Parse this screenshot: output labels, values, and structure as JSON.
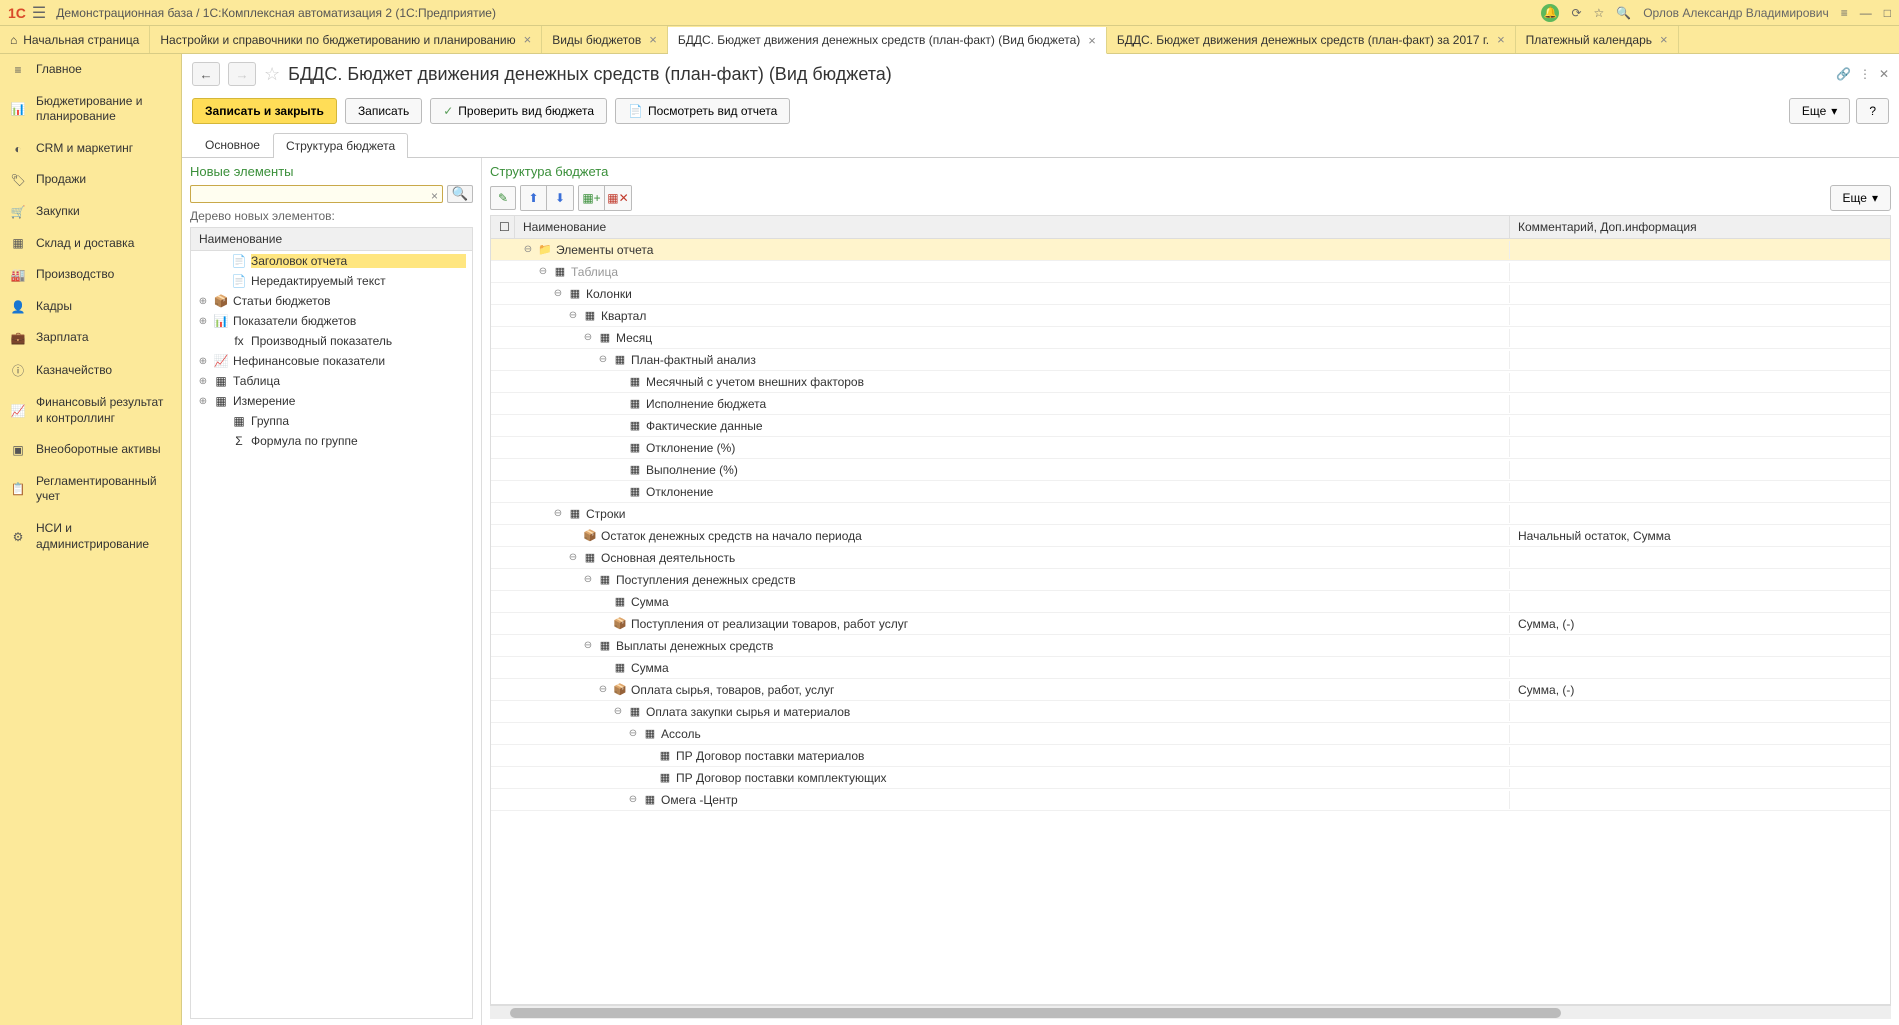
{
  "titleBar": {
    "logo": "1C",
    "title": "Демонстрационная база / 1С:Комплексная автоматизация 2 (1С:Предприятие)",
    "userName": "Орлов Александр Владимирович"
  },
  "tabs": [
    {
      "label": "Начальная страница",
      "home": true
    },
    {
      "label": "Настройки и справочники по бюджетированию и планированию",
      "closable": true
    },
    {
      "label": "Виды бюджетов",
      "closable": true
    },
    {
      "label": "БДДС. Бюджет движения денежных средств (план-факт) (Вид бюджета)",
      "closable": true,
      "active": true
    },
    {
      "label": "БДДС. Бюджет движения денежных средств (план-факт) за 2017 г.",
      "closable": true
    },
    {
      "label": "Платежный календарь",
      "closable": true
    }
  ],
  "sidebar": [
    {
      "icon": "≡",
      "label": "Главное"
    },
    {
      "icon": "📊",
      "label": "Бюджетирование и планирование"
    },
    {
      "icon": "◐",
      "label": "CRM и маркетинг"
    },
    {
      "icon": "🏷",
      "label": "Продажи"
    },
    {
      "icon": "🛒",
      "label": "Закупки"
    },
    {
      "icon": "▦",
      "label": "Склад и доставка"
    },
    {
      "icon": "🏭",
      "label": "Производство"
    },
    {
      "icon": "👤",
      "label": "Кадры"
    },
    {
      "icon": "💼",
      "label": "Зарплата"
    },
    {
      "icon": "ⓘ",
      "label": "Казначейство"
    },
    {
      "icon": "📈",
      "label": "Финансовый результат и контроллинг"
    },
    {
      "icon": "▣",
      "label": "Внеоборотные активы"
    },
    {
      "icon": "📋",
      "label": "Регламентированный учет"
    },
    {
      "icon": "⚙",
      "label": "НСИ и администрирование"
    }
  ],
  "page": {
    "title": "БДДС. Бюджет движения денежных средств (план-факт) (Вид бюджета)",
    "toolbar": {
      "saveClose": "Записать и закрыть",
      "save": "Записать",
      "check": "Проверить вид бюджета",
      "preview": "Посмотреть вид отчета",
      "more": "Еще",
      "help": "?"
    },
    "subTabs": {
      "main": "Основное",
      "structure": "Структура бюджета"
    }
  },
  "leftPanel": {
    "title": "Новые элементы",
    "treeCaption": "Дерево новых элементов:",
    "headerName": "Наименование",
    "items": [
      {
        "icon": "📄",
        "label": "Заголовок отчета",
        "highlighted": true,
        "indent": 1
      },
      {
        "icon": "📄",
        "label": "Нередактируемый текст",
        "indent": 1
      },
      {
        "icon": "📦",
        "label": "Статьи бюджетов",
        "expand": "⊕",
        "indent": 0
      },
      {
        "icon": "📊",
        "label": "Показатели бюджетов",
        "expand": "⊕",
        "indent": 0
      },
      {
        "icon": "fx",
        "label": "Производный показатель",
        "indent": 1
      },
      {
        "icon": "📈",
        "label": "Нефинансовые показатели",
        "expand": "⊕",
        "indent": 0
      },
      {
        "icon": "▦",
        "label": "Таблица",
        "expand": "⊕",
        "indent": 0
      },
      {
        "icon": "▦",
        "label": "Измерение",
        "expand": "⊕",
        "indent": 0
      },
      {
        "icon": "▦",
        "label": "Группа",
        "indent": 1
      },
      {
        "icon": "Σ",
        "label": "Формула по группе",
        "indent": 1
      }
    ]
  },
  "rightPanel": {
    "title": "Структура бюджета",
    "more": "Еще",
    "colName": "Наименование",
    "colComment": "Комментарий, Доп.информация",
    "rows": [
      {
        "indent": 0,
        "expand": "⊖",
        "icon": "📁",
        "label": "Элементы отчета",
        "comment": "",
        "selected": true
      },
      {
        "indent": 1,
        "expand": "⊖",
        "icon": "▦",
        "label": "Таблица",
        "gray": true
      },
      {
        "indent": 2,
        "expand": "⊖",
        "icon": "▦",
        "label": "Колонки"
      },
      {
        "indent": 3,
        "expand": "⊖",
        "icon": "▦",
        "label": "Квартал"
      },
      {
        "indent": 4,
        "expand": "⊖",
        "icon": "▦",
        "label": "Месяц"
      },
      {
        "indent": 5,
        "expand": "⊖",
        "icon": "▦",
        "label": "План-фактный анализ"
      },
      {
        "indent": 6,
        "expand": "",
        "icon": "▦",
        "label": "Месячный с учетом внешних факторов"
      },
      {
        "indent": 6,
        "expand": "",
        "icon": "▦",
        "label": "Исполнение бюджета"
      },
      {
        "indent": 6,
        "expand": "",
        "icon": "▦",
        "label": "Фактические данные"
      },
      {
        "indent": 6,
        "expand": "",
        "icon": "▦",
        "label": "Отклонение (%)"
      },
      {
        "indent": 6,
        "expand": "",
        "icon": "▦",
        "label": "Выполнение (%)"
      },
      {
        "indent": 6,
        "expand": "",
        "icon": "▦",
        "label": "Отклонение"
      },
      {
        "indent": 2,
        "expand": "⊖",
        "icon": "▦",
        "label": "Строки"
      },
      {
        "indent": 3,
        "expand": "",
        "icon": "📦",
        "label": "Остаток денежных средств на начало периода",
        "comment": "Начальный остаток, Сумма"
      },
      {
        "indent": 3,
        "expand": "⊖",
        "icon": "▦",
        "label": "Основная деятельность"
      },
      {
        "indent": 4,
        "expand": "⊖",
        "icon": "▦",
        "label": "Поступления денежных средств"
      },
      {
        "indent": 5,
        "expand": "",
        "icon": "▦",
        "label": "Сумма"
      },
      {
        "indent": 5,
        "expand": "",
        "icon": "📦",
        "label": "Поступления от реализации товаров, работ услуг",
        "comment": "Сумма, (-)"
      },
      {
        "indent": 4,
        "expand": "⊖",
        "icon": "▦",
        "label": "Выплаты денежных средств"
      },
      {
        "indent": 5,
        "expand": "",
        "icon": "▦",
        "label": "Сумма"
      },
      {
        "indent": 5,
        "expand": "⊖",
        "icon": "📦",
        "label": "Оплата сырья, товаров, работ, услуг",
        "comment": "Сумма, (-)"
      },
      {
        "indent": 6,
        "expand": "⊖",
        "icon": "▦",
        "label": "Оплата закупки сырья и материалов"
      },
      {
        "indent": 7,
        "expand": "⊖",
        "icon": "▦",
        "label": "Ассоль"
      },
      {
        "indent": 8,
        "expand": "",
        "icon": "▦",
        "label": "ПР Договор поставки материалов"
      },
      {
        "indent": 8,
        "expand": "",
        "icon": "▦",
        "label": "ПР Договор поставки комплектующих"
      },
      {
        "indent": 7,
        "expand": "⊖",
        "icon": "▦",
        "label": "Омега -Центр"
      }
    ]
  }
}
